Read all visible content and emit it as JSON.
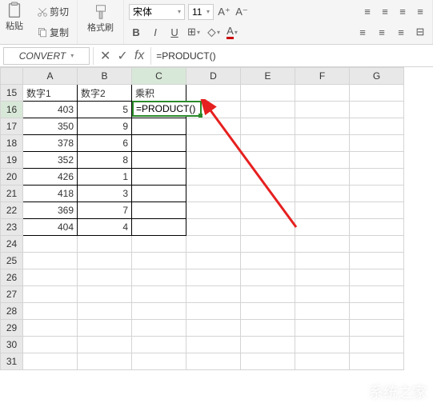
{
  "ribbon": {
    "paste_label": "粘贴",
    "cut_label": "剪切",
    "copy_label": "复制",
    "format_painter_label": "格式刷",
    "font_name": "宋体",
    "font_size": "11"
  },
  "formula_bar": {
    "name_box": "CONVERT",
    "formula": "=PRODUCT()"
  },
  "sheet": {
    "columns": [
      "A",
      "B",
      "C",
      "D",
      "E",
      "F",
      "G"
    ],
    "row_start": 15,
    "row_end": 31,
    "headers": {
      "A15": "数字1",
      "B15": "数字2",
      "C15": "乘积"
    },
    "data": [
      {
        "r": 16,
        "A": 403,
        "B": 5
      },
      {
        "r": 17,
        "A": 350,
        "B": 9
      },
      {
        "r": 18,
        "A": 378,
        "B": 6
      },
      {
        "r": 19,
        "A": 352,
        "B": 8
      },
      {
        "r": 20,
        "A": 426,
        "B": 1
      },
      {
        "r": 21,
        "A": 418,
        "B": 3
      },
      {
        "r": 22,
        "A": 369,
        "B": 7
      },
      {
        "r": 23,
        "A": 404,
        "B": 4
      }
    ],
    "active_cell": "C16",
    "editing_text": "=PRODUCT()"
  },
  "watermark": "系统之家"
}
